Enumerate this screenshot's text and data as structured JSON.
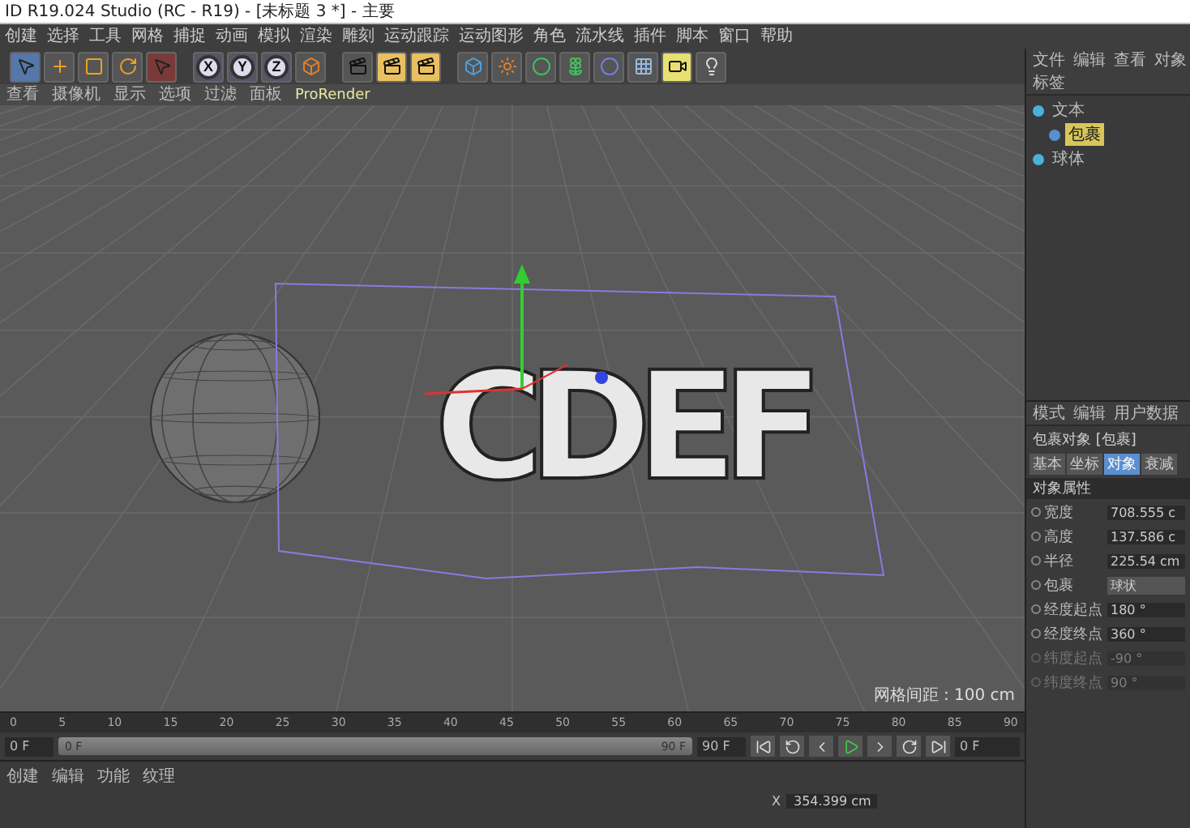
{
  "window": {
    "title": "ID R19.024 Studio (RC - R19) - [未标题 3 *] - 主要"
  },
  "menu": [
    "创建",
    "选择",
    "工具",
    "网格",
    "捕捉",
    "动画",
    "模拟",
    "渲染",
    "雕刻",
    "运动跟踪",
    "运动图形",
    "角色",
    "流水线",
    "插件",
    "脚本",
    "窗口",
    "帮助"
  ],
  "toolbar": {
    "axis_buttons": [
      "X",
      "Y",
      "Z"
    ]
  },
  "viewport": {
    "menu": [
      "查看",
      "摄像机",
      "显示",
      "选项",
      "过滤",
      "面板",
      "ProRender"
    ],
    "scene_text": "CDEF",
    "grid_spacing": "网格间距 : 100 cm"
  },
  "timeline": {
    "ticks": [
      "0",
      "5",
      "10",
      "15",
      "20",
      "25",
      "30",
      "35",
      "40",
      "45",
      "50",
      "55",
      "60",
      "65",
      "70",
      "75",
      "80",
      "85",
      "90"
    ],
    "start": "0 F",
    "range": {
      "start": "0 F",
      "end": "90 F",
      "level": 1
    },
    "end": "90 F",
    "current": "0 F"
  },
  "bottom_tabs": [
    "创建",
    "编辑",
    "功能",
    "纹理"
  ],
  "coordinates": {
    "x_label": "X",
    "x_value": "354.399 cm"
  },
  "object_manager": {
    "menu": [
      "文件",
      "编辑",
      "查看",
      "对象",
      "标签"
    ],
    "objects": [
      {
        "name": "文本",
        "selected": false,
        "children": [
          {
            "name": "包裹",
            "selected": true
          }
        ]
      },
      {
        "name": "球体",
        "selected": false
      }
    ]
  },
  "attributes": {
    "menu": [
      "模式",
      "编辑",
      "用户数据"
    ],
    "object": "包裹对象 [包裹]",
    "tabs": [
      {
        "label": "基本",
        "selected": false
      },
      {
        "label": "坐标",
        "selected": false
      },
      {
        "label": "对象",
        "selected": true
      },
      {
        "label": "衰减",
        "selected": false
      }
    ],
    "section": "对象属性",
    "fields": [
      {
        "kind": "number",
        "label": "宽度",
        "value": "708.555 c",
        "disabled": false
      },
      {
        "kind": "number",
        "label": "高度",
        "value": "137.586 c",
        "disabled": false
      },
      {
        "kind": "number",
        "label": "半径",
        "value": "225.54 cm",
        "disabled": false
      },
      {
        "kind": "dropdown",
        "label": "包裹",
        "value": "球状",
        "disabled": false
      },
      {
        "kind": "number",
        "label": "经度起点",
        "value": "180 °",
        "disabled": false
      },
      {
        "kind": "number",
        "label": "经度终点",
        "value": "360 °",
        "disabled": false
      },
      {
        "kind": "number",
        "label": "纬度起点",
        "value": "-90 °",
        "disabled": true
      },
      {
        "kind": "number",
        "label": "纬度终点",
        "value": "90 °",
        "disabled": true
      }
    ]
  }
}
